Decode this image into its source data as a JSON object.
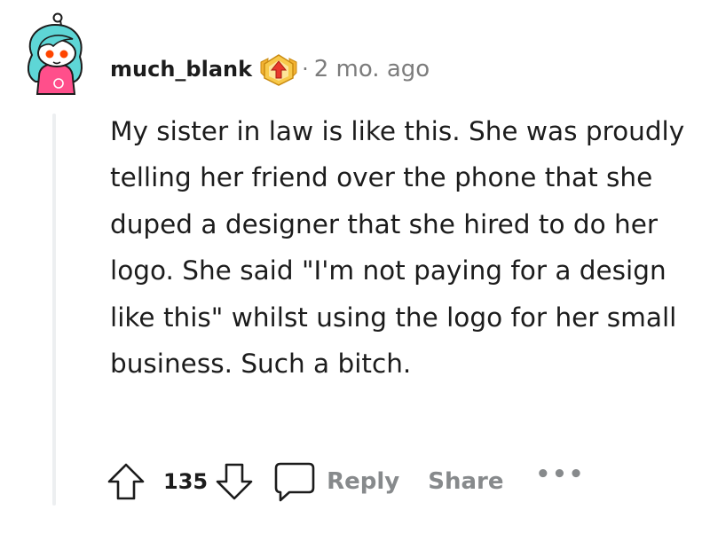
{
  "comment": {
    "username": "much_blank",
    "separator": "·",
    "timestamp": "2 mo. ago",
    "body": "My sister in law is like this. She was proudly telling her friend over the phone that she duped a designer that she hired to do her logo. She said \"I'm not paying for a design like this\" whilst using the logo for her small business. Such a bitch.",
    "avatar_icon": "snoo-avatar-icon",
    "flair_icon": "achievement-badge-icon"
  },
  "actions": {
    "upvote_icon": "upvote-arrow-icon",
    "score": "135",
    "downvote_icon": "downvote-arrow-icon",
    "comment_icon": "comment-bubble-icon",
    "reply_label": "Reply",
    "share_label": "Share",
    "more_label": "•••"
  },
  "colors": {
    "text": "#1c1c1c",
    "muted": "#7c7c7c",
    "action": "#878a8c",
    "thread_line": "#edeff1",
    "avatar_hair": "#5ed6d6",
    "avatar_shirt": "#ff4f8b",
    "flair_gold": "#f2b233",
    "flair_red": "#e8392c"
  }
}
